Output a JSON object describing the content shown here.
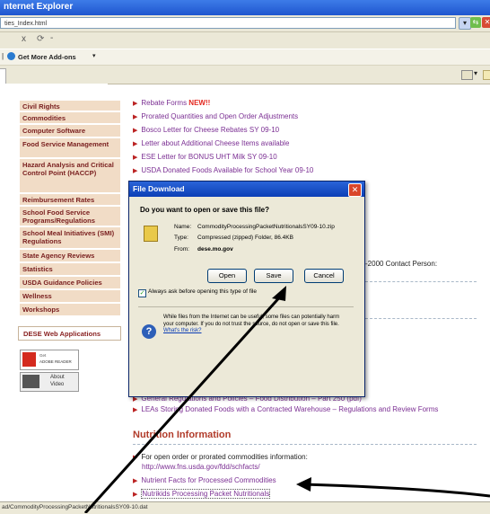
{
  "window": {
    "title": "nternet Explorer"
  },
  "address_bar": {
    "value": "ties_Index.html"
  },
  "search_row": {
    "close_glyph": "x",
    "refresh_glyph": "⟳",
    "dropdown_glyph": "-"
  },
  "addons": {
    "label": "Get More Add-ons",
    "dropdown_glyph": "▾"
  },
  "left_nav": {
    "items": [
      "Civil Rights",
      "Commodities",
      "Computer Software",
      "Food Service Management",
      "Hazard Analysis and Critical Control Point (HACCP)",
      "Reimbursement Rates",
      "School Food Service Programs/Regulations",
      "School Meal Initiatives (SMI) Regulations",
      "State Agency Reviews",
      "Statistics",
      "USDA Guidance Policies",
      "Wellness",
      "Workshops"
    ],
    "dese_apps": "DESE Web Applications",
    "adobe": {
      "get": "Get",
      "reader": "ADOBE READER"
    },
    "about_video": {
      "line1": "About",
      "line2": "Video"
    }
  },
  "main": {
    "links_top": [
      {
        "text": "Rebate Forms ",
        "badge": "NEW!!"
      },
      {
        "text": "Prorated Quantities and Open Order Adjustments"
      },
      {
        "text": "Bosco Letter for Cheese Rebates SY 09-10"
      },
      {
        "text": "Letter about Additional Cheese Items available"
      },
      {
        "text": "ESE Letter for BONUS UHT Milk SY 09-10"
      },
      {
        "text": "USDA Donated Foods Available for School Year 09-10"
      }
    ],
    "partial_text": "-2000  Contact Person:",
    "link_general": "General Regulations and Policies – Food Distribution – Part 250 (pdf)",
    "link_leas": "LEAs Storing Donated Foods with a Contracted Warehouse – Regulations and Review Forms",
    "section_title": "Nutrition Information",
    "nutrition_item1": "For open order or prorated commodities information:",
    "nutrition_item1_url": "http://www.fns.usda.gov/fdd/schfacts/",
    "nutrition_item2": "Nutrient Facts for Processed Commodities",
    "nutrition_item3": "Nutrikids Processing Packet Nutritionals"
  },
  "dialog": {
    "title": "File Download",
    "question": "Do you want to open or save this file?",
    "name_label": "Name:",
    "name_value": "CommodityProcessingPacketNutritionalsSY09-10.zip",
    "type_label": "Type:",
    "type_value": "Compressed (zipped) Folder, 86.4KB",
    "from_label": "From:",
    "from_value": "dese.mo.gov",
    "open_label": "Open",
    "save_label": "Save",
    "cancel_label": "Cancel",
    "checkbox_label": "Always ask before opening this type of file",
    "warning_text": "While files from the Internet can be useful, some files can potentially harm your computer. If you do not trust the source, do not open or save this file.",
    "risk_link": "What's the risk?"
  },
  "status_bar": {
    "text": "ad/CommodityProcessingPacketNutritionalsSY09-10.dat"
  }
}
